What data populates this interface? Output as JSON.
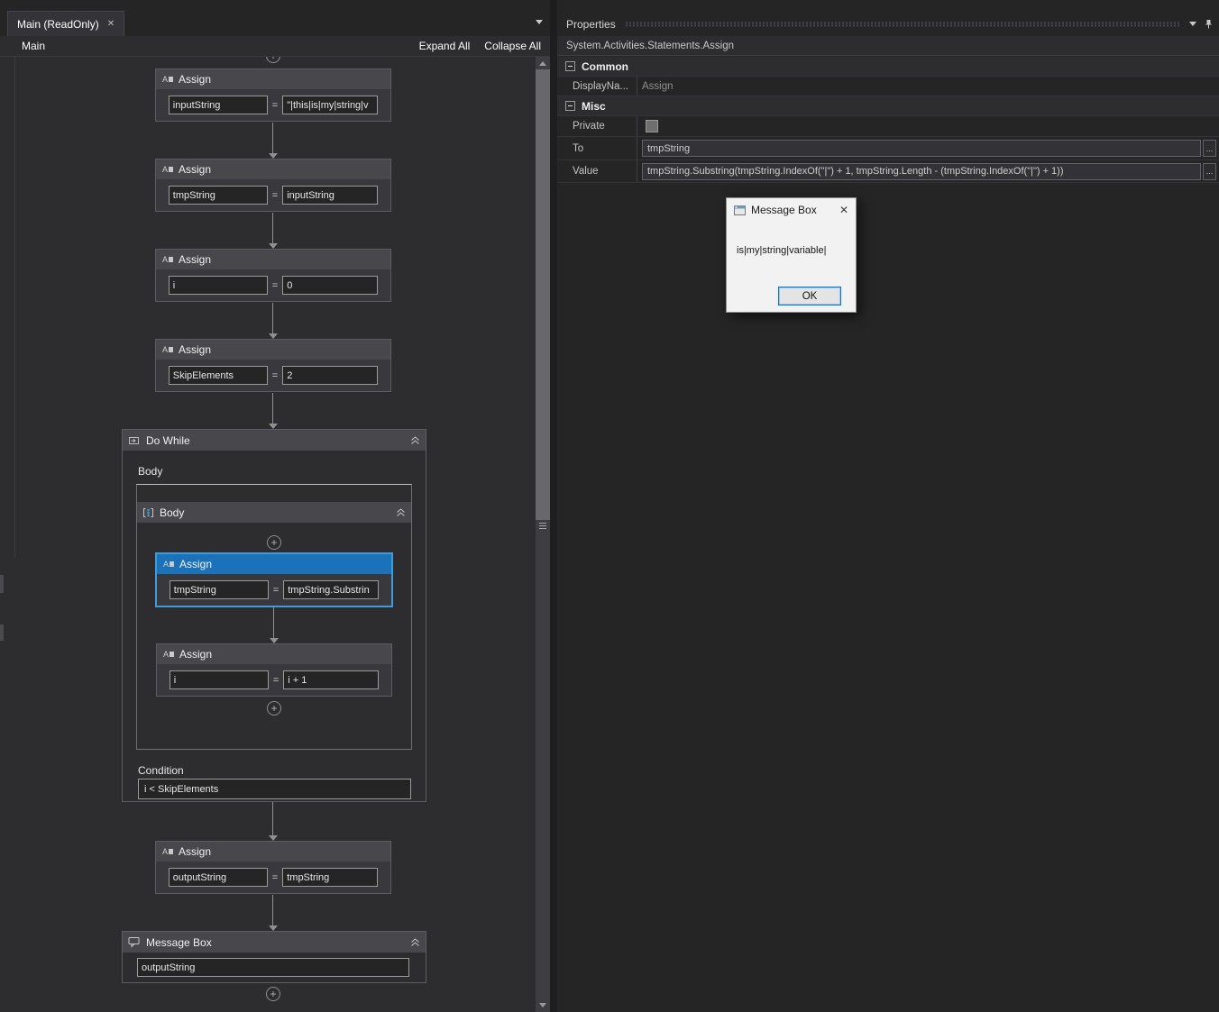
{
  "colors": {
    "selection_blue": "#1c72b8",
    "selection_border": "#3f9bdc",
    "dialog_accent": "#0078d7"
  },
  "icons": {
    "plus": "+",
    "close": "✕",
    "assign_letter": "A",
    "ellipsis": "..."
  },
  "editor": {
    "tab_title": "Main (ReadOnly)",
    "breadcrumb": "Main",
    "expand_all": "Expand All",
    "collapse_all": "Collapse All"
  },
  "workflow": {
    "assign1": {
      "title": "Assign",
      "to": "inputString",
      "op": "=",
      "value": "\"|this|is|my|string|v"
    },
    "assign2": {
      "title": "Assign",
      "to": "tmpString",
      "op": "=",
      "value": "inputString"
    },
    "assign3": {
      "title": "Assign",
      "to": "i",
      "op": "=",
      "value": "0"
    },
    "assign4": {
      "title": "Assign",
      "to": "SkipElements",
      "op": "=",
      "value": "2"
    },
    "do_while": {
      "title": "Do While",
      "body_label": "Body",
      "sequence_title": "Body",
      "assign5": {
        "title": "Assign",
        "to": "tmpString",
        "op": "=",
        "value": "tmpString.Substrin"
      },
      "assign6": {
        "title": "Assign",
        "to": "i",
        "op": "=",
        "value": "i + 1"
      },
      "condition_label": "Condition",
      "condition": "i < SkipElements"
    },
    "assign7": {
      "title": "Assign",
      "to": "outputString",
      "op": "=",
      "value": "tmpString"
    },
    "message_box": {
      "title": "Message Box",
      "value": "outputString"
    }
  },
  "properties": {
    "panel_title": "Properties",
    "type_name": "System.Activities.Statements.Assign",
    "common_label": "Common",
    "display_name_label": "DisplayNa...",
    "display_name_value": "Assign",
    "misc_label": "Misc",
    "private_label": "Private",
    "to_label": "To",
    "to_value": "tmpString",
    "value_label": "Value",
    "value_value": "tmpString.Substring(tmpString.IndexOf(\"|\") + 1, tmpString.Length - (tmpString.IndexOf(\"|\") + 1))"
  },
  "dialog": {
    "title": "Message Box",
    "message": "is|my|string|variable|",
    "ok_label": "OK"
  }
}
